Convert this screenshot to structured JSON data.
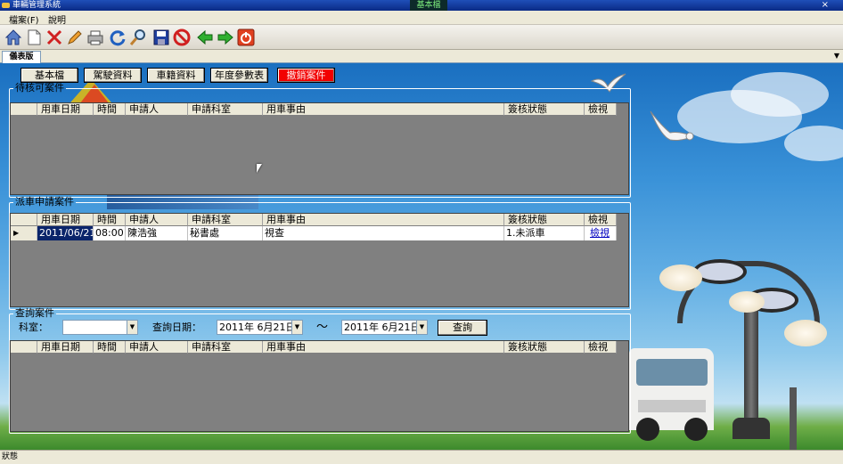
{
  "window": {
    "app_title": "車輛管理系統",
    "active_module": "基本檔",
    "close_glyph": "×"
  },
  "menu": {
    "items": [
      "檔案(F)",
      "說明"
    ]
  },
  "toolbar": {
    "icons": [
      "home-icon",
      "new-document-icon",
      "delete-icon",
      "edit-pencil-icon",
      "print-icon",
      "refresh-icon",
      "search-icon",
      "save-icon",
      "cancel-icon",
      "back-arrow-icon",
      "forward-arrow-icon",
      "exit-icon"
    ]
  },
  "tabs": {
    "active": "儀表版"
  },
  "top_buttons": [
    "基本檔",
    "駕駛資料",
    "車籍資料",
    "年度參數表",
    "撤銷案件"
  ],
  "colors": {
    "danger": "#f20000",
    "selection": "#0a246a",
    "grid_bg": "#808080",
    "link": "#0000c0"
  },
  "pending": {
    "legend": "待核可案件",
    "columns": [
      "用車日期",
      "時間",
      "申請人",
      "申請科室",
      "用車事由",
      "簽核狀態",
      "檢視"
    ]
  },
  "dispatch": {
    "legend": "派車申請案件",
    "columns": [
      "用車日期",
      "時間",
      "申請人",
      "申請科室",
      "用車事由",
      "簽核狀態",
      "檢視"
    ],
    "rows": [
      {
        "date": "2011/06/21",
        "time": "08:00",
        "applicant": "陳浩強",
        "dept": "秘書處",
        "reason": "視查",
        "status": "1.未派車",
        "view": "檢視"
      }
    ]
  },
  "query": {
    "legend": "查詢案件",
    "dept_label": "科室：",
    "dept_value": "",
    "date_label": "查詢日期：",
    "date_from": "2011年 6月21日",
    "tilde": "～",
    "date_to": "2011年 6月21日",
    "button": "查詢",
    "columns": [
      "用車日期",
      "時間",
      "申請人",
      "申請科室",
      "用車事由",
      "簽核狀態",
      "檢視"
    ]
  },
  "status": {
    "text": "狀態"
  }
}
